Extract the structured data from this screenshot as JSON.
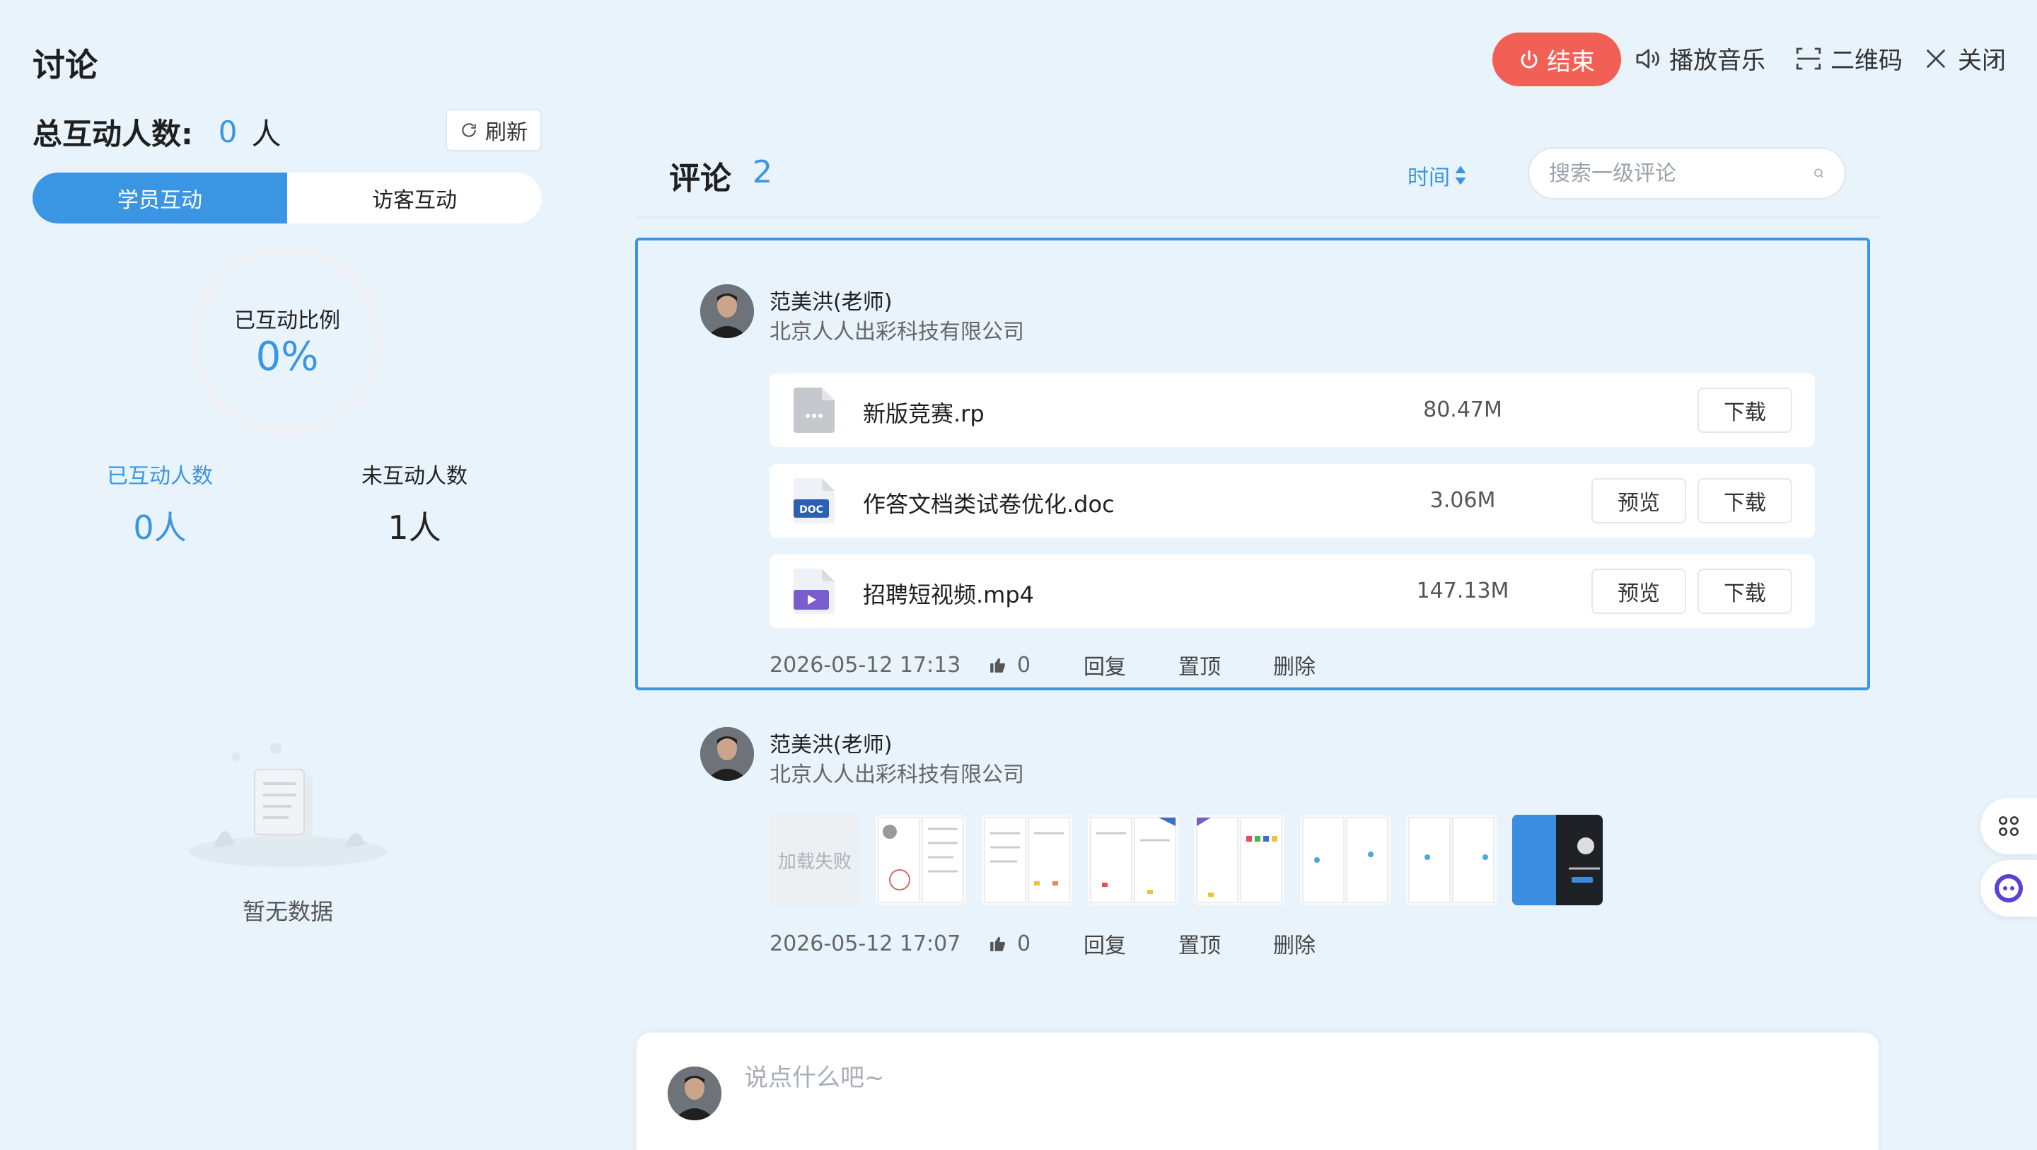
{
  "sidebar": {
    "title": "讨论",
    "total_label": "总互动人数:",
    "total_count": "0",
    "total_unit": "人",
    "refresh_label": "刷新",
    "tabs": [
      {
        "label": "学员互动",
        "active": true
      },
      {
        "label": "访客互动",
        "active": false
      }
    ],
    "ratio_label": "已互动比例",
    "ratio_value": "0%",
    "interacted_label": "已互动人数",
    "interacted_value": "0人",
    "not_interacted_label": "未互动人数",
    "not_interacted_value": "1人",
    "empty_text": "暂无数据"
  },
  "toolbar": {
    "end_label": "结束",
    "music_label": "播放音乐",
    "qrcode_label": "二维码",
    "close_label": "关闭"
  },
  "comments": {
    "title": "评论",
    "count": "2",
    "sort_label": "时间",
    "search_placeholder": "搜索一级评论",
    "items": [
      {
        "author": "范美洪(老师)",
        "org": "北京人人出彩科技有限公司",
        "files": [
          {
            "name": "新版竞赛.rp",
            "size": "80.47M",
            "type": "other",
            "preview": false,
            "download_label": "下载"
          },
          {
            "name": "作答文档类试卷优化.doc",
            "size": "3.06M",
            "type": "doc",
            "preview": true,
            "preview_label": "预览",
            "download_label": "下载"
          },
          {
            "name": "招聘短视频.mp4",
            "size": "147.13M",
            "type": "video",
            "preview": true,
            "preview_label": "预览",
            "download_label": "下载"
          }
        ],
        "time": "2026-05-12 17:13",
        "likes": "0",
        "reply_label": "回复",
        "pin_label": "置顶",
        "delete_label": "删除",
        "selected": true
      },
      {
        "author": "范美洪(老师)",
        "org": "北京人人出彩科技有限公司",
        "images_failed_label": "加载失败",
        "time": "2026-05-12 17:07",
        "likes": "0",
        "reply_label": "回复",
        "pin_label": "置顶",
        "delete_label": "删除"
      }
    ]
  },
  "composer": {
    "placeholder": "说点什么吧~"
  },
  "colors": {
    "accent": "#3a95e3",
    "danger": "#f26055",
    "background": "#e8f3fb"
  }
}
